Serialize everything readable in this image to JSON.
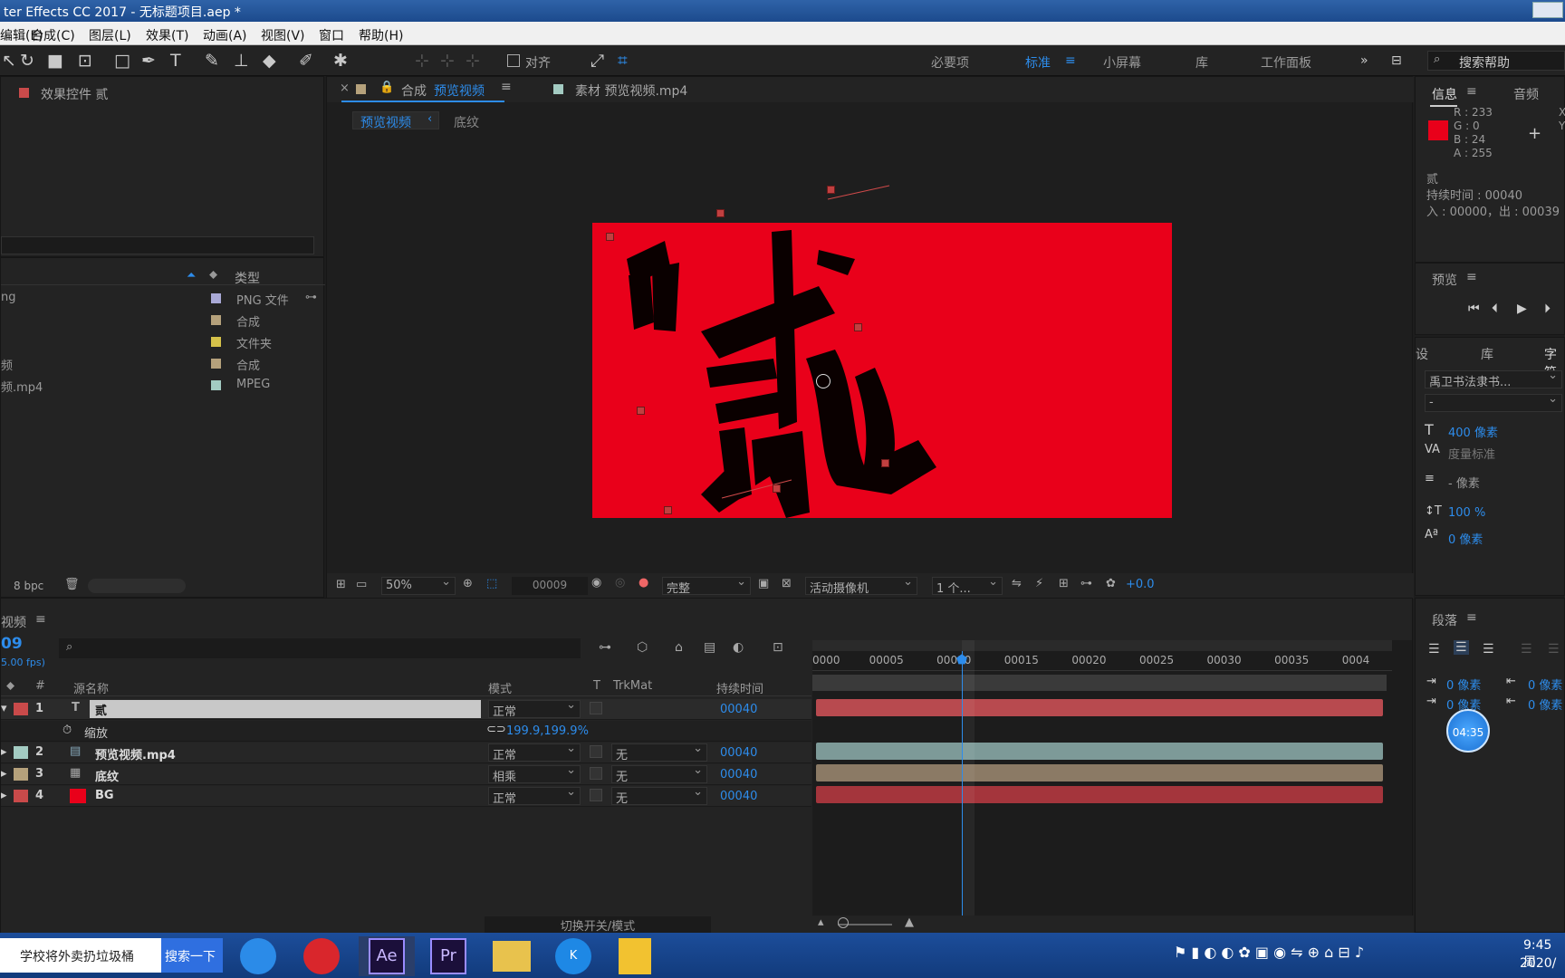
{
  "window": {
    "title": "ter Effects CC 2017 - 无标题项目.aep *"
  },
  "menu": [
    "编辑(E)",
    "合成(C)",
    "图层(L)",
    "效果(T)",
    "动画(A)",
    "视图(V)",
    "窗口",
    "帮助(H)"
  ],
  "toolbar": {
    "align_label": "对齐",
    "workspaces": [
      "必要项",
      "标准",
      "小屏幕",
      "库",
      "工作面板"
    ],
    "search_placeholder": "搜索帮助"
  },
  "effects_panel": {
    "title": "效果控件 贰"
  },
  "project": {
    "column_type": "类型",
    "items": [
      {
        "name": "ng",
        "type": "PNG 文件",
        "color": "#a9a9d6"
      },
      {
        "name": "",
        "type": "合成",
        "color": "#b5a17b"
      },
      {
        "name": "",
        "type": "文件夹",
        "color": "#d6c24a"
      },
      {
        "name": "频",
        "type": "合成",
        "color": "#b5a17b"
      },
      {
        "name": "频.mp4",
        "type": "MPEG",
        "color": "#a3cbc2"
      }
    ],
    "bpc": "8 bpc"
  },
  "comp_viewer": {
    "tab_comp_prefix": "合成",
    "tab_comp_name": "预览视频",
    "tab_footage": "素材 预览视频.mp4",
    "breadcrumb_active": "预览视频",
    "breadcrumb_next": "底纹",
    "zoom": "50%",
    "timecode": "00009",
    "resolution": "完整",
    "camera": "活动摄像机",
    "views": "1 个...",
    "exposure": "+0.0",
    "bg_color": "#e9001a"
  },
  "info_panel": {
    "tabs": [
      "信息",
      "音频"
    ],
    "rgba": [
      "R : 233",
      "G : 0",
      "B : 24",
      "A : 255"
    ],
    "swatch": "#e9001a",
    "xy": [
      "X",
      "Y"
    ],
    "layer_name": "贰",
    "duration": "持续时间 : 00040",
    "inout": "入 : 00000，出 : 00039"
  },
  "preview_panel": {
    "title": "预览"
  },
  "character_panel": {
    "tabs": [
      "设",
      "库",
      "字符"
    ],
    "font": "禹卫书法隶书...",
    "style": "-",
    "size": "400 像素",
    "kerning": "度量标准",
    "leading": "- 像素",
    "vscale": "100 %",
    "baseline": "0 像素"
  },
  "paragraph_panel": {
    "title": "段落",
    "indent_values": [
      "0 像素",
      "0 像素",
      "0 像素",
      "0 像素"
    ],
    "time_badge": "04:35"
  },
  "timeline": {
    "tab": "视频",
    "timecode": "09",
    "fps": "5.00 fps)",
    "col_hash": "#",
    "col_name": "源名称",
    "col_mode": "模式",
    "col_t": "T",
    "col_trkmat": "TrkMat",
    "col_duration": "持续时间",
    "ruler": [
      "0000",
      "00005",
      "00010",
      "00015",
      "00020",
      "00025",
      "00030",
      "00035",
      "0004"
    ],
    "playhead_frame": 9,
    "total_frames": 40,
    "layers": [
      {
        "num": "1",
        "name": "贰",
        "mode": "正常",
        "trkmat": "",
        "duration": "00040",
        "label": "#c94a4a",
        "bar": "#b84a4f"
      },
      {
        "num": "2",
        "name": "预览视频.mp4",
        "mode": "正常",
        "trkmat": "无",
        "duration": "00040",
        "label": "#a3cbc2",
        "bar": "#7d9a98"
      },
      {
        "num": "3",
        "name": "底纹",
        "mode": "相乘",
        "trkmat": "无",
        "duration": "00040",
        "label": "#b5a17b",
        "bar": "#8b7a65"
      },
      {
        "num": "4",
        "name": "BG",
        "mode": "正常",
        "trkmat": "无",
        "duration": "00040",
        "label": "#c94a4a",
        "bar": "#a4353c"
      }
    ],
    "prop_name": "缩放",
    "prop_value": "199.9,199.9%",
    "footer_toggle": "切换开关/模式"
  },
  "taskbar": {
    "search_text": "学校将外卖扔垃圾桶",
    "search_button": "搜索一下",
    "time": "9:45 周",
    "date": "2020/"
  }
}
